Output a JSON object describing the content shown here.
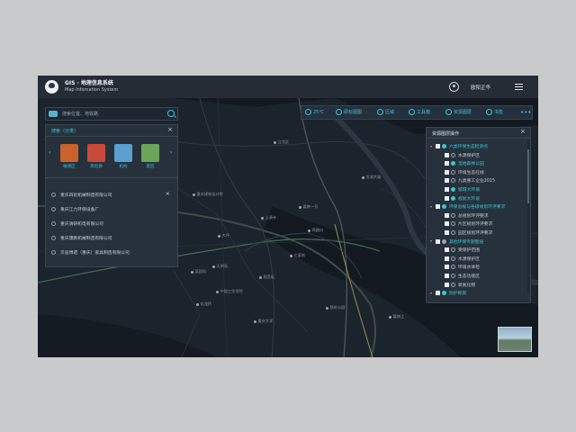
{
  "header": {
    "title": "GIS · 地理信息系统",
    "subtitle": "Map Infomation System",
    "user_name": "欧阳正华"
  },
  "toolbar": {
    "items": [
      {
        "label": "25℃",
        "icon": "sun-icon"
      },
      {
        "label": "即标图图",
        "icon": "pen-icon"
      },
      {
        "label": "区域",
        "icon": "area-icon"
      },
      {
        "label": "工具箱",
        "icon": "gear-icon"
      },
      {
        "label": "资源图层",
        "icon": "layers-icon"
      },
      {
        "label": "书签",
        "icon": "bookmark-icon"
      }
    ],
    "more": "•••"
  },
  "search": {
    "placeholder": "搜索位置、地铁路"
  },
  "search_panel": {
    "title": "搜索（分类）",
    "categories": [
      {
        "label": "敏感区",
        "color": "#c9622b"
      },
      {
        "label": "风险源",
        "color": "#c94a3a"
      },
      {
        "label": "机构",
        "color": "#5a9fd0"
      },
      {
        "label": "景区",
        "color": "#6aa55a"
      }
    ],
    "companies": [
      "重庆四轮机械制造有限公司",
      "重庆江力环保设备厂",
      "重庆清研机电有限公司",
      "重庆康鹏机械制造有限公司",
      "贝迪博诺（重庆）家具制造有限公司"
    ]
  },
  "layer_panel": {
    "title": "资源图层操作",
    "layers": [
      {
        "label": "六类环保生态检测点",
        "checked": true,
        "level": 0,
        "color": "#3ac6d6",
        "dot": "fill"
      },
      {
        "label": "水源保护区",
        "checked": false,
        "level": 1,
        "color": "#c4ccd4",
        "dot": "hollow"
      },
      {
        "label": "湿地森林公园",
        "checked": false,
        "level": 1,
        "color": "#3ac6d6",
        "dot": "fill"
      },
      {
        "label": "环境生态红线",
        "checked": false,
        "level": 1,
        "color": "#c4ccd4",
        "dot": "hollow"
      },
      {
        "label": "九类重工企业2015",
        "checked": false,
        "level": 1,
        "color": "#c4ccd4",
        "dot": "hollow"
      },
      {
        "label": "城域大环境",
        "checked": false,
        "level": 1,
        "color": "#3ac6d6",
        "dot": "fill"
      },
      {
        "label": "规划大环境",
        "checked": false,
        "level": 1,
        "color": "#3ac6d6",
        "dot": "fill"
      },
      {
        "label": "环保总规与各级规划环评要求",
        "checked": true,
        "level": 0,
        "color": "#3ac6d6",
        "dot": "fill"
      },
      {
        "label": "总规划环评要求",
        "checked": false,
        "level": 1,
        "color": "#c4ccd4",
        "dot": "hollow"
      },
      {
        "label": "片区规划环评要求",
        "checked": false,
        "level": 1,
        "color": "#c4ccd4",
        "dot": "hollow"
      },
      {
        "label": "园区规划环评要求",
        "checked": false,
        "level": 1,
        "color": "#c4ccd4",
        "dot": "hollow"
      },
      {
        "label": "其他环保专题图层",
        "checked": true,
        "level": 0,
        "color": "#3ac6d6",
        "dot": "gray"
      },
      {
        "label": "受保护范围",
        "checked": false,
        "level": 1,
        "color": "#c4ccd4",
        "dot": "hollow"
      },
      {
        "label": "水源保护区",
        "checked": false,
        "level": 1,
        "color": "#c4ccd4",
        "dot": "hollow"
      },
      {
        "label": "环境水体检",
        "checked": false,
        "level": 1,
        "color": "#c4ccd4",
        "dot": "hollow"
      },
      {
        "label": "生态功能区",
        "checked": false,
        "level": 1,
        "color": "#c4ccd4",
        "dot": "hollow"
      },
      {
        "label": "氧氮化物",
        "checked": false,
        "level": 1,
        "color": "#c4ccd4",
        "dot": "hollow"
      },
      {
        "label": "防护距离",
        "checked": true,
        "level": 0,
        "color": "#3ac6d6",
        "dot": "fill"
      }
    ]
  },
  "map": {
    "pois": [
      "重庆建筑设计院",
      "天明苑",
      "中国工作学院",
      "嘉陵一号",
      "龙湖大厦",
      "重庆大学",
      "两路口",
      "江北区",
      "嘉陵江",
      "上清寺",
      "大坪",
      "菜园坝",
      "观音岩",
      "七星岗",
      "鹅岭公园",
      "化龙桥"
    ]
  }
}
